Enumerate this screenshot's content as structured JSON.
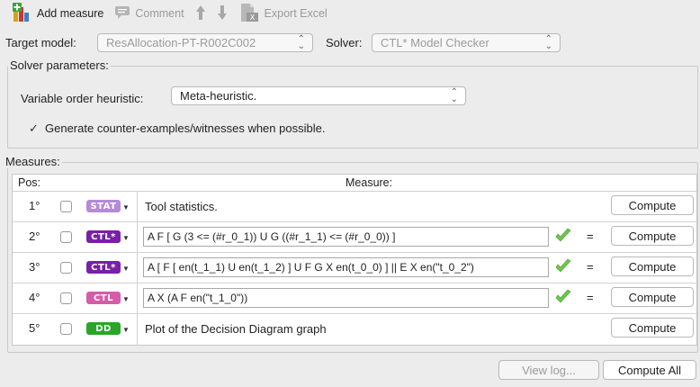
{
  "toolbar": {
    "add_measure": "Add measure",
    "comment": "Comment",
    "export_excel": "Export Excel"
  },
  "target": {
    "label": "Target model:",
    "value": "ResAllocation-PT-R002C002",
    "solver_label": "Solver:",
    "solver_value": "CTL* Model Checker"
  },
  "solver_params": {
    "title": "Solver parameters:",
    "heuristic_label": "Variable order heuristic:",
    "heuristic_value": "Meta-heuristic.",
    "generate_label": "Generate counter-examples/witnesses when possible.",
    "generate_checked": "✓"
  },
  "measures": {
    "title": "Measures:",
    "header_pos": "Pos:",
    "header_measure": "Measure:",
    "compute_label": "Compute",
    "eq_sign": "=",
    "rows": [
      {
        "pos": "1°",
        "badge": "STAT",
        "badge_color": "#b58ad8",
        "measure": "Tool statistics."
      },
      {
        "pos": "2°",
        "badge": "CTL*",
        "badge_color": "#7a1fa8",
        "measure": "A F [ G (3 <= (#r_0_1)) U G ((#r_1_1) <= (#r_0_0)) ]"
      },
      {
        "pos": "3°",
        "badge": "CTL*",
        "badge_color": "#7a1fa8",
        "measure": "A [ F [ en(t_1_1) U en(t_1_2) ] U F G X en(t_0_0) ]  ||  E X en(\"t_0_2\")"
      },
      {
        "pos": "4°",
        "badge": "CTL",
        "badge_color": "#d65ba8",
        "measure": "A X (A F en(\"t_1_0\"))"
      },
      {
        "pos": "5°",
        "badge": "DD",
        "badge_color": "#2aa52a",
        "measure": "Plot of the Decision Diagram graph"
      }
    ]
  },
  "footer": {
    "view_log": "View log...",
    "compute_all": "Compute All"
  }
}
